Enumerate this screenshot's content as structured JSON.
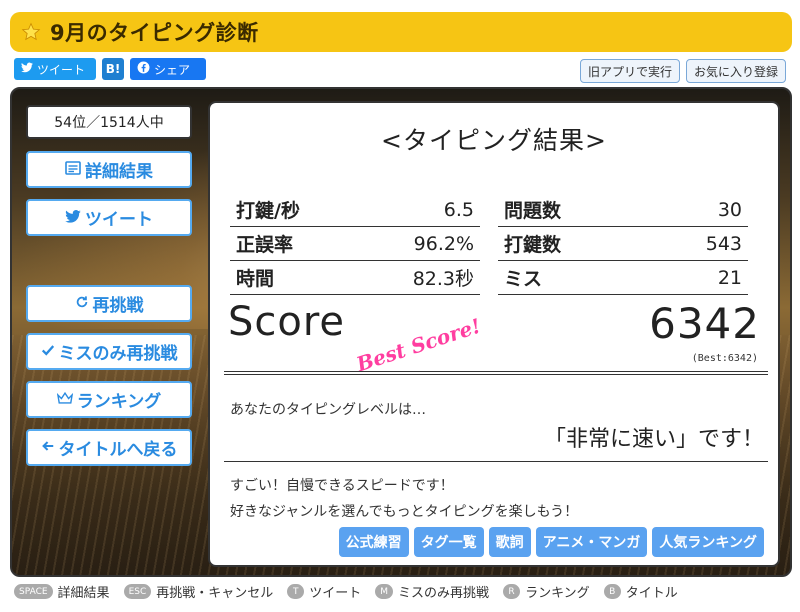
{
  "header": {
    "title": "9月のタイピング診断",
    "accent": "#f6c514"
  },
  "share": {
    "tweet_label": "ツイート",
    "hatena_label": "B!",
    "facebook_label": "シェア"
  },
  "top_right": {
    "old_app_label": "旧アプリで実行",
    "favorite_label": "お気に入り登録"
  },
  "rank": {
    "text": "54位／1514人中"
  },
  "left_menu": {
    "detail_label": "詳細結果",
    "tweet_label": "ツイート",
    "retry_label": "再挑戦",
    "retry_miss_label": "ミスのみ再挑戦",
    "ranking_label": "ランキング",
    "back_label": "タイトルへ戻る"
  },
  "result": {
    "heading": "<タイピング結果>",
    "stats_left": [
      {
        "key": "打鍵/秒",
        "value": "6.5"
      },
      {
        "key": "正誤率",
        "value": "96.2%"
      },
      {
        "key": "時間",
        "value": "82.3秒"
      }
    ],
    "stats_right": [
      {
        "key": "問題数",
        "value": "30"
      },
      {
        "key": "打鍵数",
        "value": "543"
      },
      {
        "key": "ミス",
        "value": "21"
      }
    ],
    "score_label": "Score",
    "best_badge": "Best Score!",
    "score_value": "6342",
    "best_small": "(Best:6342)",
    "level_question": "あなたのタイピングレベルは…",
    "level_answer": "「非常に速い」です！",
    "message1": "すごい！自慢できるスピードです！",
    "message2": "好きなジャンルを選んでもっとタイピングを楽しもう！",
    "tags": [
      "公式練習",
      "タグ一覧",
      "歌詞",
      "アニメ・マンガ",
      "人気ランキング"
    ]
  },
  "shortcuts": [
    {
      "key": "SPACE",
      "label": "詳細結果"
    },
    {
      "key": "ESC",
      "label": "再挑戦・キャンセル"
    },
    {
      "key": "T",
      "label": "ツイート"
    },
    {
      "key": "M",
      "label": "ミスのみ再挑戦"
    },
    {
      "key": "R",
      "label": "ランキング"
    },
    {
      "key": "B",
      "label": "タイトル"
    }
  ]
}
